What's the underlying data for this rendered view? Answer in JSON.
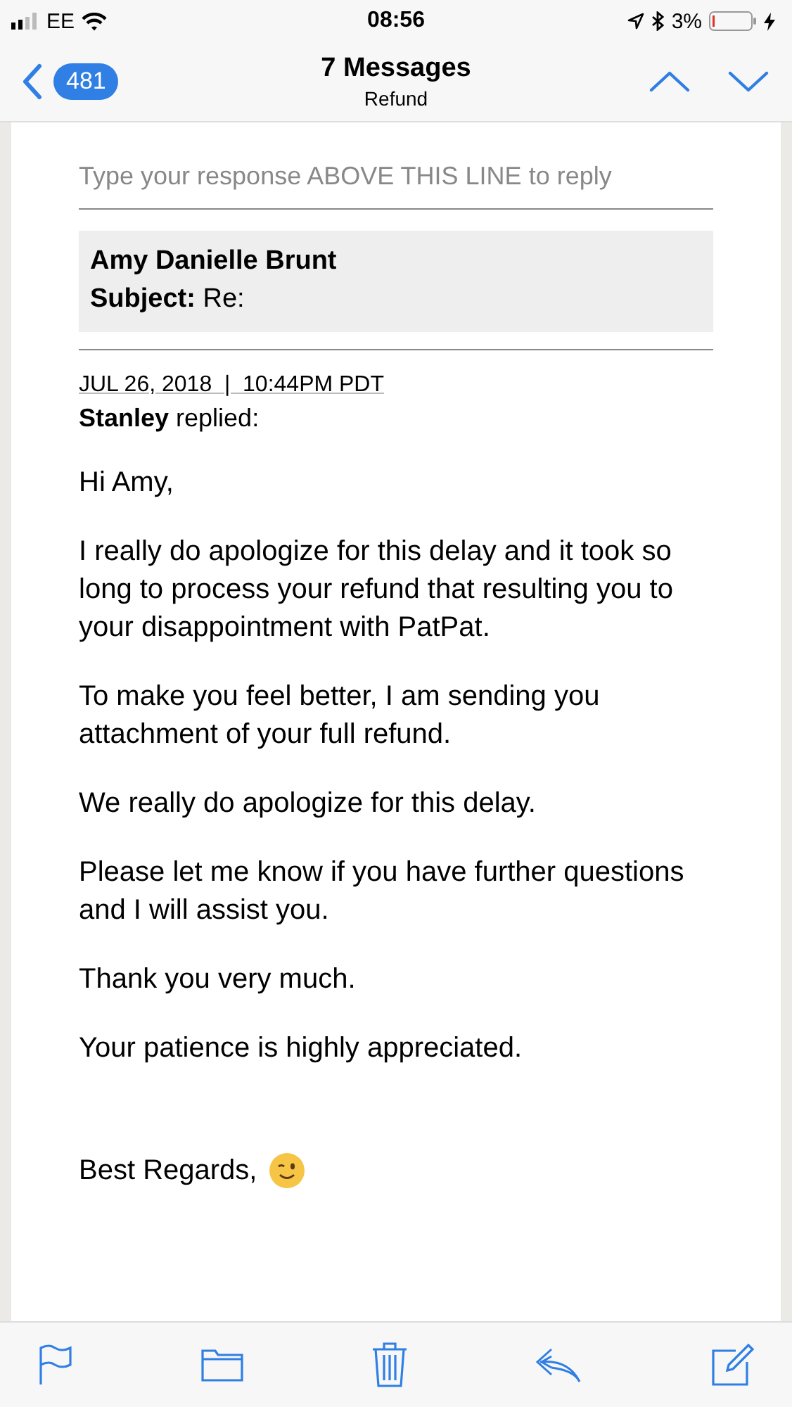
{
  "status_bar": {
    "carrier": "EE",
    "time": "08:56",
    "battery": "3%"
  },
  "nav": {
    "back_count": "481",
    "title": "7 Messages",
    "subtitle": "Refund"
  },
  "email": {
    "reply_hint": "Type your response ABOVE THIS LINE to reply",
    "header": {
      "name": "Amy Danielle Brunt",
      "subject_label": "Subject:",
      "subject": "Re:"
    },
    "date": "JUL 26, 2018  |  10:44PM PDT",
    "replied": "**Stanley** replied:",
    "paragraphs": [
      {
        "text": "Hi Amy,"
      },
      {
        "text": "I really do apologize for this delay and it took so long to process your refund that resulting you to your disappointment with PatPat."
      },
      {
        "text": "To make you feel better, I am sending you attachment of your full refund."
      },
      {
        "text": "We really do apologize for this delay."
      },
      {
        "text": "Please let me know if you have further questions and I will assist you."
      },
      {
        "text": "Thank you very much."
      },
      {
        "text": "Your patience is highly appreciated."
      }
    ],
    "closing": "Best Regards,"
  }
}
